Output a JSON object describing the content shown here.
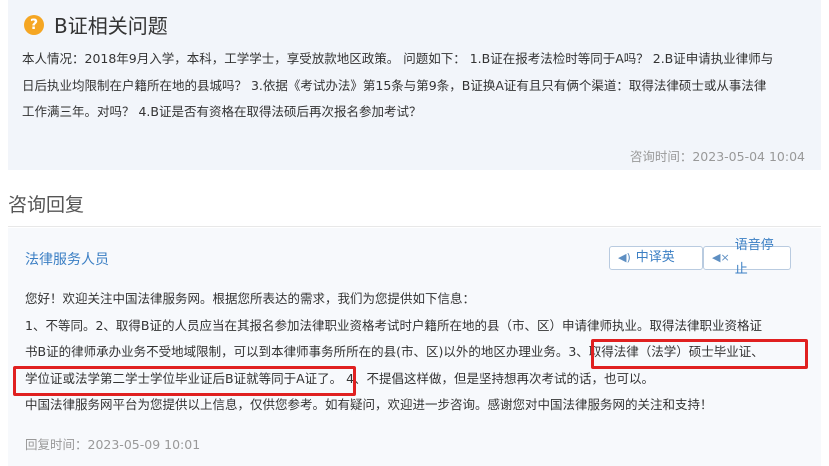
{
  "question": {
    "icon": "question-mark-icon",
    "title": "B证相关问题",
    "body_lines": [
      "本人情况：2018年9月入学，本科，工学学士，享受放款地区政策。 问题如下： 1.B证在报考法检时等同于A吗？ 2.B证申请执业律师与",
      "日后执业均限制在户籍所在地的县城吗？ 3.依据《考试办法》第15条与第9条，B证换A证有且只有俩个渠道：取得法律硕士或从事法律",
      "工作满三年。对吗？ 4.B证是否有资格在取得法硕后再次报名参加考试？"
    ],
    "time": "咨询时间：2023-05-04 10:04"
  },
  "reply_section": {
    "title": "咨询回复",
    "answerer": "法律服务人员",
    "translate_label": "中译英",
    "stop_label": "语音停止",
    "body_lines": [
      "您好！欢迎关注中国法律服务网。根据您所表达的需求，我们为您提供如下信息：",
      "1、不等同。2、取得B证的人员应当在其报名参加法律职业资格考试时户籍所在地的县（市、区）申请律师执业。取得法律职业资格证",
      "书B证的律师承办业务不受地域限制，可以到本律师事务所所在的县(市、区)以外的地区办理业务。3、取得法律（法学）硕士毕业证、",
      "学位证或法学第二学士学位毕业证后B证就等同于A证了。 4、不提倡这样做，但是坚持想再次考试的话，也可以。",
      "中国法律服务网平台为您提供以上信息，仅供您参考。如有疑问，欢迎进一步咨询。感谢您对中国法律服务网的关注和支持！"
    ],
    "time": "回复时间：2023-05-09 10:01"
  },
  "colors": {
    "accent": "#3b7fc4",
    "highlight": "#e02020",
    "question_icon": "#f5a623"
  }
}
